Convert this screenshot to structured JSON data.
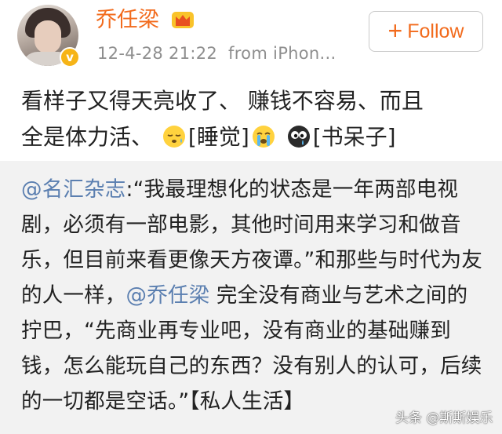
{
  "header": {
    "username": "乔任梁",
    "timestamp": "12-4-28 21:22",
    "source": "from iPhon...",
    "follow_label": "Follow",
    "vip_badge": "v"
  },
  "post": {
    "line1": "看样子又得天亮收了、 赚钱不容易、而且",
    "line2_text": "全是体力活、",
    "tag_sleep": "[睡觉]",
    "tag_nerd": "[书呆子]"
  },
  "repost": {
    "mention1": "@名汇杂志",
    "segment1": ":“我最理想化的状态是一年两部电视剧，必须有一部电影，其他时间用来学习和做音乐，但目前来看更像天方夜谭。”和那些与时代为友的人一样，",
    "mention2": "@乔任梁",
    "segment2": " 完全没有商业与艺术之间的拧巴，“先商业再专业吧，没有商业的基础赚到钱，怎么能玩自己的东西？没有别人的认可，后续的一切都是空话。”【私人生活】"
  },
  "watermark": "头条 @斯斯娱乐",
  "colors": {
    "username": "#f26b1d",
    "mention": "#5b7fb0",
    "repost_bg": "#f2f2f2",
    "meta": "#8e8e8e"
  },
  "icons": [
    "avatar",
    "vip-badge-icon",
    "crown-icon",
    "plus-icon",
    "sleepy-emoji-icon",
    "crying-emoji-icon",
    "nerd-emoji-icon"
  ]
}
